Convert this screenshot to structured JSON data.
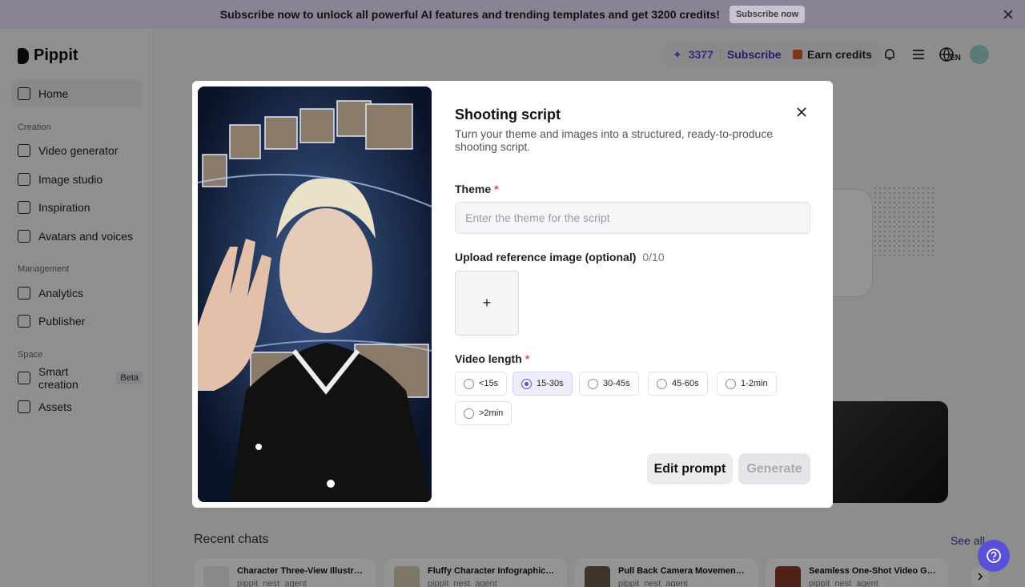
{
  "banner": {
    "text": "Subscribe now to unlock all powerful AI features and trending templates and get 3200 credits!",
    "button_label": "Subscribe now"
  },
  "brand": {
    "name": "Pippit"
  },
  "sidebar": {
    "home_label": "Home",
    "sections": [
      {
        "title": "Creation",
        "items": [
          "Video generator",
          "Image studio",
          "Inspiration",
          "Avatars and voices"
        ]
      },
      {
        "title": "Management",
        "items": [
          "Analytics",
          "Publisher"
        ]
      },
      {
        "title": "Space",
        "items": [
          "Smart creation",
          "Assets"
        ]
      }
    ],
    "beta_badge": "Beta"
  },
  "topbar": {
    "credits": "3377",
    "subscribe_label": "Subscribe",
    "earn_label": "Earn credits",
    "language": "EN"
  },
  "recent": {
    "title": "Recent chats",
    "see_all": "See all",
    "chats": [
      {
        "title": "Character Three-View Illustra…",
        "sub": "pippit_nest_agent"
      },
      {
        "title": "Fluffy Character Infographic …",
        "sub": "pippit_nest_agent"
      },
      {
        "title": "Pull Back Camera Movement …",
        "sub": "pippit_nest_agent"
      },
      {
        "title": "Seamless One-Shot Video G…",
        "sub": "pippit_nest_agent"
      }
    ]
  },
  "modal": {
    "title": "Shooting script",
    "subtitle": "Turn your theme and images into a structured, ready-to-produce shooting script.",
    "theme_label": "Theme",
    "required_mark": "*",
    "theme_placeholder": "Enter the theme for the script",
    "upload_label": "Upload reference image (optional)",
    "upload_count": "0/10",
    "upload_plus": "+",
    "video_length_label": "Video length",
    "video_length_options": [
      "<15s",
      "15-30s",
      "30-45s",
      "45-60s",
      "1-2min",
      ">2min"
    ],
    "video_length_selected": "15-30s",
    "edit_prompt_label": "Edit prompt",
    "generate_label": "Generate"
  },
  "colors": {
    "accent": "#5a4fd8",
    "banner_bg": "#8c8296",
    "required": "#e5484d"
  }
}
